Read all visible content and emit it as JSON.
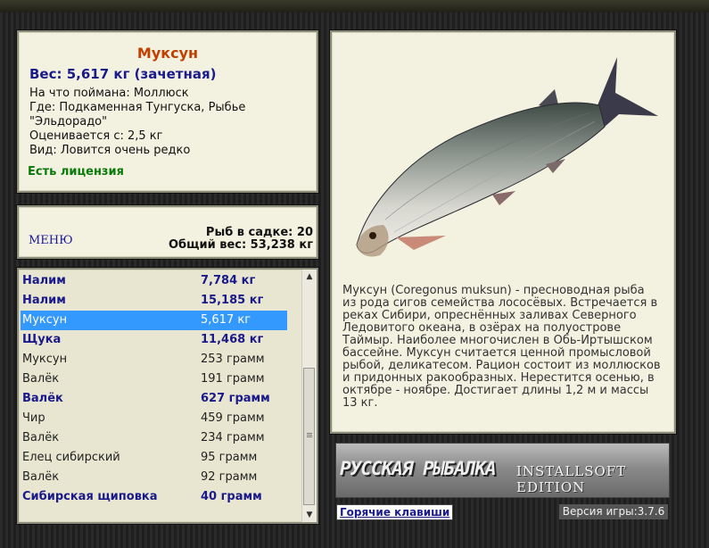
{
  "fish": {
    "name": "Муксун",
    "weight_line": "Вес: 5,617 кг (зачетная)",
    "details": [
      "На что поймана: Моллюск",
      "Где: Подкаменная Тунгуска, Рыбье",
      "\"Эльдорадо\"",
      "Оценивается с: 2,5 кг",
      "Вид: Ловится очень редко"
    ],
    "license": "Есть лицензия"
  },
  "menu": {
    "label": "МЕНЮ",
    "count_line": "Рыб в садке: 20",
    "total_line": "Общий вес: 53,238 кг"
  },
  "catch_list": [
    {
      "name": "Налим",
      "weight": "7,784 кг",
      "bold": true,
      "selected": false
    },
    {
      "name": "Налим",
      "weight": "15,185 кг",
      "bold": true,
      "selected": false
    },
    {
      "name": "Муксун",
      "weight": "5,617 кг",
      "bold": false,
      "selected": true
    },
    {
      "name": "Щука",
      "weight": "11,468 кг",
      "bold": true,
      "selected": false
    },
    {
      "name": "Муксун",
      "weight": "253 грамм",
      "bold": false,
      "selected": false
    },
    {
      "name": "Валёк",
      "weight": "191 грамм",
      "bold": false,
      "selected": false
    },
    {
      "name": "Валёк",
      "weight": "627 грамм",
      "bold": true,
      "selected": false
    },
    {
      "name": "Чир",
      "weight": "459 грамм",
      "bold": false,
      "selected": false
    },
    {
      "name": "Валёк",
      "weight": "234 грамм",
      "bold": false,
      "selected": false
    },
    {
      "name": "Елец сибирский",
      "weight": "95 грамм",
      "bold": false,
      "selected": false
    },
    {
      "name": "Валёк",
      "weight": "92 грамм",
      "bold": false,
      "selected": false
    },
    {
      "name": "Сибирская щиповка",
      "weight": "40 грамм",
      "bold": true,
      "selected": false
    }
  ],
  "description": "Муксун (Coregonus muksun) - пресноводная рыба из рода сигов семейства лососёвых. Встречается в реках Сибири, опреснённых заливах Северного Ледовитого океана, в озёрах на полуострове Таймыр. Наиболее многочислен в Обь-Иртышском бассейне. Муксун считается ценной промысловой рыбой, деликатесом. Рацион состоит из моллюсков и придонных ракообразных. Нерестится осенью, в октябре - ноябре. Достигает длины 1,2 м и массы 13 кг.",
  "logo": {
    "main": "РУССКАЯ РЫБАЛКА",
    "edition": "INSTALLSOFT EDITION"
  },
  "footer": {
    "hotkeys": "Горячие клавиши",
    "version": "Версия игры:3.7.6"
  }
}
